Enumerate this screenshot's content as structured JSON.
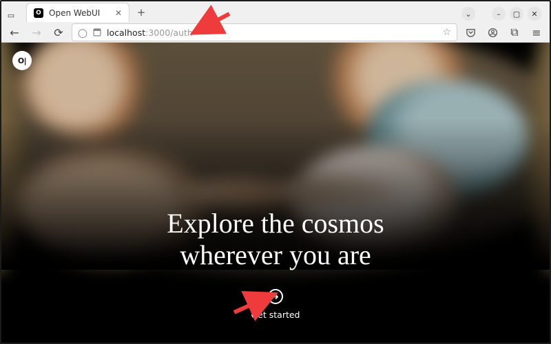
{
  "browser": {
    "tab_title": "Open WebUI",
    "url_host": "localhost",
    "url_path": ":3000/auth"
  },
  "page": {
    "logo_text": "O|",
    "headline_line1": "Explore the cosmos",
    "headline_line2": "wherever you are",
    "cta_label": "Get started"
  },
  "icons": {
    "back": "←",
    "forward": "→",
    "reload": "⟳",
    "shield": "◯",
    "star": "☆",
    "pocket": "⌄",
    "account": "◉",
    "ext": "⧉",
    "menu": "≡",
    "min": "–",
    "max": "▢",
    "close": "✕",
    "overflow": "⌄",
    "newtab": "+",
    "closetab": "✕",
    "session": "▭"
  }
}
